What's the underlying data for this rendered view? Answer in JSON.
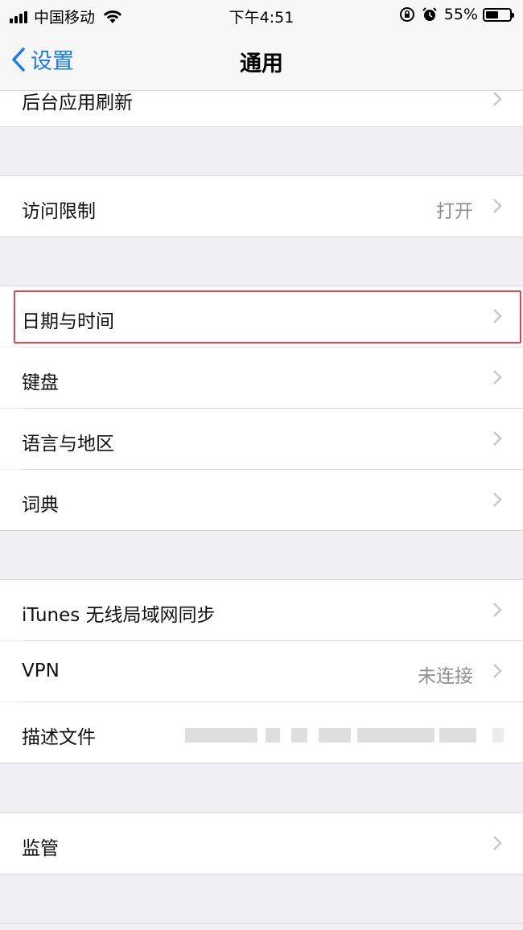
{
  "status": {
    "carrier": "中国移动",
    "time": "下午4:51",
    "battery": "55%",
    "battery_level": 0.55
  },
  "nav": {
    "back_label": "设置",
    "title": "通用"
  },
  "rows": {
    "background_refresh": "后台应用刷新",
    "restrictions": {
      "label": "访问限制",
      "detail": "打开"
    },
    "date_time": "日期与时间",
    "keyboard": "键盘",
    "language_region": "语言与地区",
    "dictionary": "词典",
    "itunes_sync": "iTunes 无线局域网同步",
    "vpn": {
      "label": "VPN",
      "detail": "未连接"
    },
    "profiles": "描述文件",
    "supervision": "监管"
  },
  "colors": {
    "accent": "#1a7cf5",
    "highlight": "#e8464c"
  }
}
